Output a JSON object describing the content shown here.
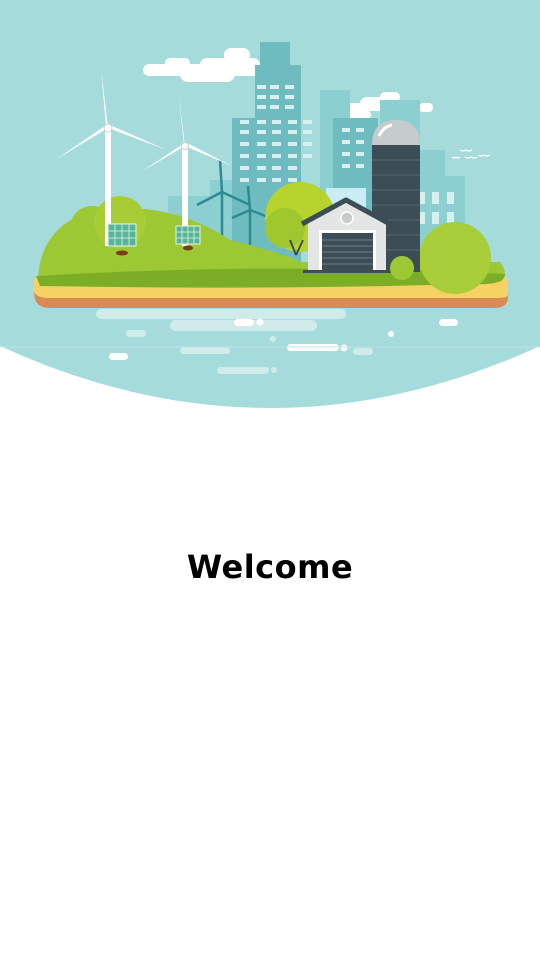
{
  "welcome": {
    "title": "Welcome"
  },
  "illustration": {
    "subject": "green-energy-island-with-city",
    "colors": {
      "sky": "#a6dbdc",
      "grass": "#9cc834",
      "sand": "#f6d264",
      "soil": "#d98a55",
      "building": "#7fc6c8",
      "silo": "#3c4d55"
    }
  }
}
